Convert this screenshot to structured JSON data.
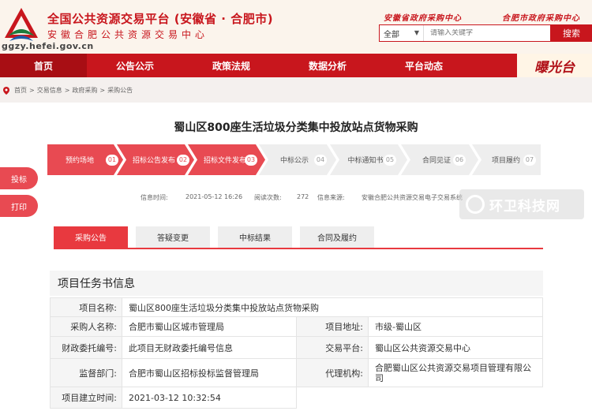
{
  "header": {
    "title": "全国公共资源交易平台 (安徽省 · 合肥市)",
    "subtitle": "安徽合肥公共资源交易中心",
    "domain": "ggzy.hefei.gov.cn",
    "slogan_left": "安徽省政府采购中心",
    "slogan_right": "合肥市政府采购中心",
    "search_scope": "全部",
    "search_placeholder": "请输入关键字",
    "search_button": "搜索"
  },
  "nav": {
    "items": [
      "首页",
      "公告公示",
      "政策法规",
      "数据分析",
      "平台动态"
    ],
    "badge": "曝光台"
  },
  "breadcrumb": [
    "首页",
    "交易信息",
    "政府采购",
    "采购公告"
  ],
  "page_title": "蜀山区800座生活垃圾分类集中投放站点货物采购",
  "steps": [
    {
      "label": "预约场地",
      "num": "01"
    },
    {
      "label": "招标公告发布",
      "num": "02"
    },
    {
      "label": "招标文件发布",
      "num": "03"
    },
    {
      "label": "中标公示",
      "num": "04"
    },
    {
      "label": "中标通知书",
      "num": "05"
    },
    {
      "label": "合同见证",
      "num": "06"
    },
    {
      "label": "项目履约",
      "num": "07"
    }
  ],
  "side_buttons": [
    "投标",
    "打印"
  ],
  "meta": {
    "time_label": "信息时间:",
    "time": "2021-05-12 16:26",
    "views_label": "阅读次数:",
    "views": "272",
    "source_label": "信息来源:",
    "source": "安徽合肥公共资源交易电子交易系统"
  },
  "watermark": "环卫科技网",
  "tabs": [
    "采购公告",
    "答疑变更",
    "中标结果",
    "合同及履约"
  ],
  "section_title": "项目任务书信息",
  "fields": {
    "project_name_label": "项目名称:",
    "project_name": "蜀山区800座生活垃圾分类集中投放站点货物采购",
    "buyer_label": "采购人名称:",
    "buyer": "合肥市蜀山区城市管理局",
    "location_label": "项目地址:",
    "location": "市级-蜀山区",
    "fin_label": "财政委托编号:",
    "fin": "此项目无财政委托编号信息",
    "platform_label": "交易平台:",
    "platform": "蜀山区公共资源交易中心",
    "supervisor_label": "监督部门:",
    "supervisor": "合肥市蜀山区招标投标监督管理局",
    "agent_label": "代理机构:",
    "agent": "合肥蜀山区公共资源交易项目管理有限公司",
    "created_label": "项目建立时间:",
    "created": "2021-03-12 10:32:54"
  },
  "colors": {
    "brand_red": "#c8161d",
    "step_active": "#e84a52",
    "step_inactive": "#eeeeee"
  }
}
